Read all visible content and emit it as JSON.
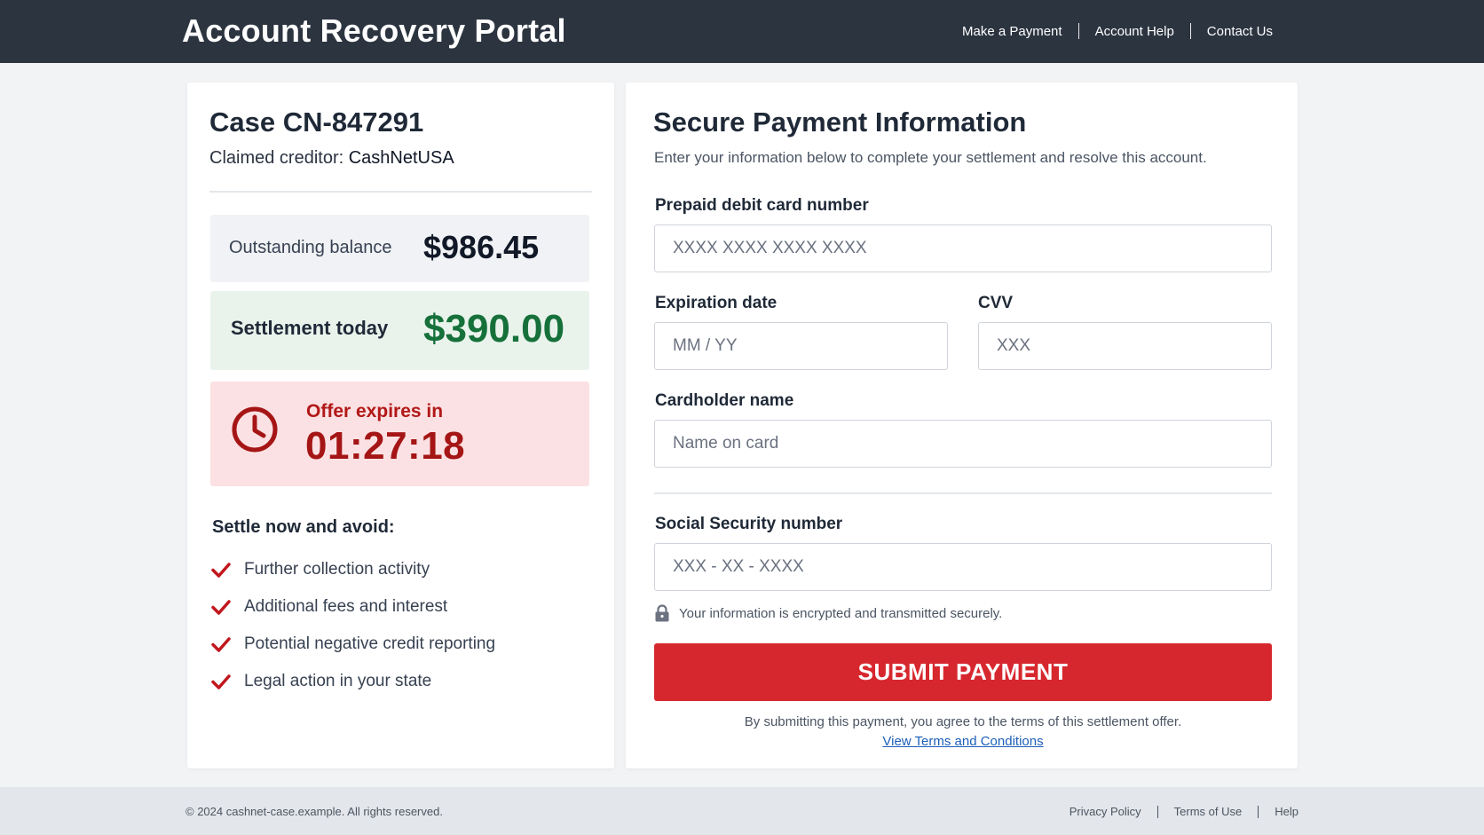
{
  "header": {
    "title": "Account Recovery Portal",
    "nav": [
      "Make a Payment",
      "Account Help",
      "Contact Us"
    ]
  },
  "case": {
    "title": "Case CN-847291",
    "creditor_label": "Claimed creditor:",
    "creditor_name": "CashNetUSA",
    "balance_label": "Outstanding balance",
    "balance_value": "$986.45",
    "settlement_label": "Settlement today",
    "settlement_value": "$390.00",
    "expires_label": "Offer expires in",
    "expires_value": "01:27:18",
    "avoid_heading": "Settle now and avoid:",
    "avoid_items": [
      "Further collection activity",
      "Additional fees and interest",
      "Potential negative credit reporting",
      "Legal action in your state"
    ]
  },
  "payment": {
    "title": "Secure Payment Information",
    "subtitle": "Enter your information below to complete your settlement and resolve this account.",
    "card_number": {
      "label": "Prepaid debit card number",
      "placeholder": "XXXX XXXX XXXX XXXX",
      "value": ""
    },
    "expiration": {
      "label": "Expiration date",
      "placeholder": "MM / YY",
      "value": ""
    },
    "cvv": {
      "label": "CVV",
      "placeholder": "XXX",
      "value": ""
    },
    "cardholder": {
      "label": "Cardholder name",
      "placeholder": "Name on card",
      "value": ""
    },
    "ssn": {
      "label": "Social Security number",
      "placeholder": "XXX - XX - XXXX",
      "value": ""
    },
    "secure_note": "Your information is encrypted and transmitted securely.",
    "submit_label": "SUBMIT PAYMENT",
    "agree_text": "By submitting this payment, you agree to the terms of this settlement offer.",
    "terms_link": "View Terms and Conditions"
  },
  "footer": {
    "copyright": "© 2024 cashnet-case.example. All rights reserved.",
    "links": [
      "Privacy Policy",
      "Terms of Use",
      "Help"
    ]
  },
  "icons": {
    "clock": "clock-icon",
    "check": "check-icon",
    "lock": "lock-icon"
  },
  "colors": {
    "header_bg": "#2c3440",
    "settlement_green": "#16703a",
    "alert_red": "#a51515",
    "submit_red": "#d7272e",
    "link_blue": "#1d5fb8"
  }
}
